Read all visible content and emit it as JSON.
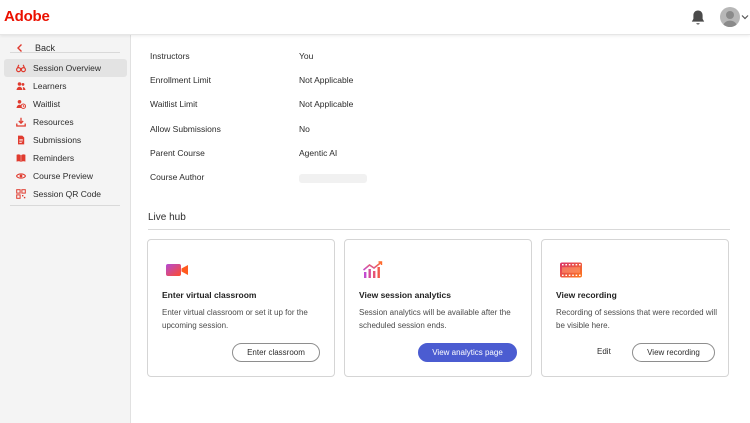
{
  "header": {
    "brand": "Adobe"
  },
  "sidebar": {
    "back": "Back",
    "items": [
      {
        "label": "Session Overview",
        "icon": "binoculars-icon"
      },
      {
        "label": "Learners",
        "icon": "users-icon"
      },
      {
        "label": "Waitlist",
        "icon": "user-clock-icon"
      },
      {
        "label": "Resources",
        "icon": "download-icon"
      },
      {
        "label": "Submissions",
        "icon": "document-icon"
      },
      {
        "label": "Reminders",
        "icon": "book-icon"
      },
      {
        "label": "Course Preview",
        "icon": "eye-icon"
      },
      {
        "label": "Session QR Code",
        "icon": "qr-code-icon"
      }
    ]
  },
  "details": [
    {
      "label": "Instructors",
      "value": "You"
    },
    {
      "label": "Enrollment Limit",
      "value": "Not Applicable"
    },
    {
      "label": "Waitlist Limit",
      "value": "Not Applicable"
    },
    {
      "label": "Allow Submissions",
      "value": "No"
    },
    {
      "label": "Parent Course",
      "value": "Agentic AI"
    },
    {
      "label": "Course Author",
      "value": ""
    }
  ],
  "livehub": {
    "title": "Live hub",
    "cards": [
      {
        "title": "Enter virtual classroom",
        "desc": "Enter virtual classroom or set it up for the upcoming session.",
        "button": "Enter classroom",
        "icon": "video-camera-icon"
      },
      {
        "title": "View session analytics",
        "desc": "Session analytics will be available after the scheduled session ends.",
        "button": "View analytics page",
        "icon": "analytics-chart-icon"
      },
      {
        "title": "View recording",
        "desc": "Recording of sessions that were recorded will be visible here.",
        "edit": "Edit",
        "button": "View recording",
        "icon": "film-strip-icon"
      }
    ]
  },
  "colors": {
    "brand": "#eb1000",
    "primary": "#4b5cd1",
    "sidebar_icon": "#e03b2f"
  }
}
